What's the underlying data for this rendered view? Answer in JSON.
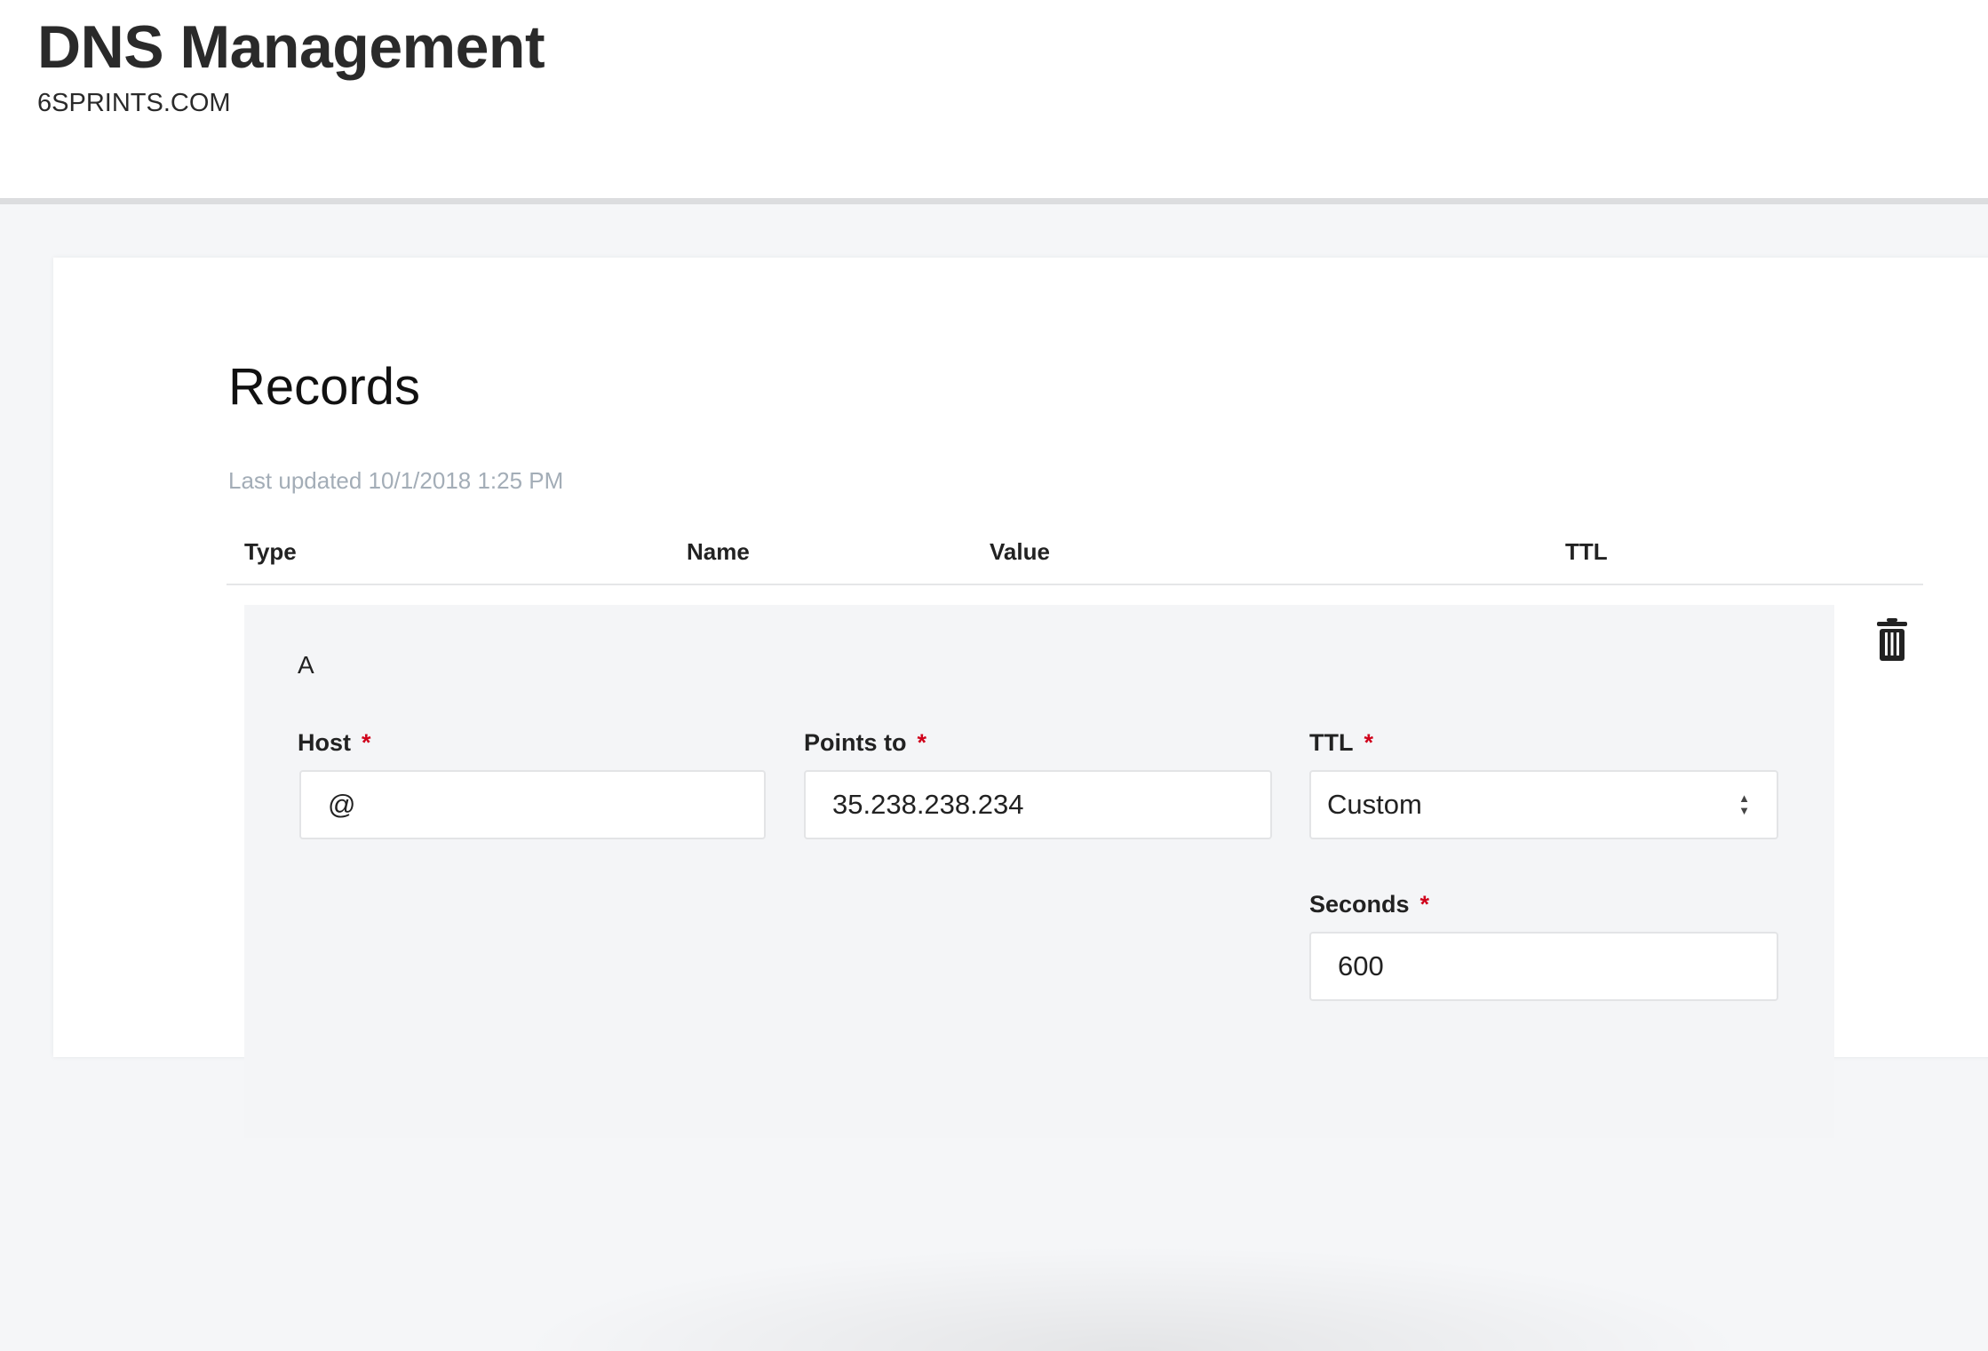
{
  "header": {
    "title": "DNS Management",
    "domain": "6SPRINTS.COM"
  },
  "records": {
    "title": "Records",
    "last_updated": "Last updated 10/1/2018 1:25 PM",
    "columns": [
      "Type",
      "Name",
      "Value",
      "TTL"
    ],
    "record": {
      "type": "A",
      "host_label": "Host",
      "host_value": "@",
      "points_label": "Points to",
      "points_value": "35.238.238.234",
      "ttl_label": "TTL",
      "ttl_value": "Custom",
      "seconds_label": "Seconds",
      "seconds_value": "600",
      "required_mark": "*"
    }
  }
}
